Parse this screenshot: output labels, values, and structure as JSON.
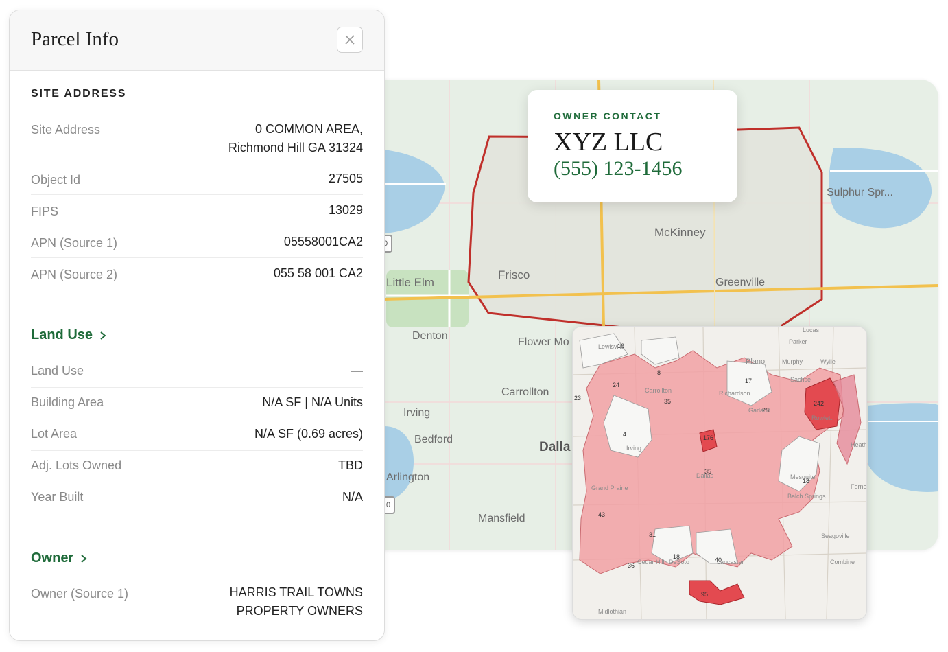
{
  "panel": {
    "title": "Parcel Info",
    "close_icon": "close-icon",
    "site_section": {
      "heading": "SITE ADDRESS",
      "rows": [
        {
          "label": "Site Address",
          "value_line1": "0 COMMON AREA,",
          "value_line2": "Richmond Hill GA 31324"
        },
        {
          "label": "Object Id",
          "value": "27505"
        },
        {
          "label": "FIPS",
          "value": "13029"
        },
        {
          "label": "APN (Source 1)",
          "value": "05558001CA2"
        },
        {
          "label": "APN (Source 2)",
          "value": "055 58 001 CA2"
        }
      ]
    },
    "land_use_section": {
      "link": "Land Use",
      "rows": [
        {
          "label": "Land Use",
          "value": "—"
        },
        {
          "label": "Building Area",
          "value": "N/A SF | N/A Units"
        },
        {
          "label": "Lot Area",
          "value": "N/A SF (0.69 acres)"
        },
        {
          "label": "Adj. Lots Owned",
          "value": "TBD"
        },
        {
          "label": "Year Built",
          "value": "N/A"
        }
      ]
    },
    "owner_section": {
      "link": "Owner",
      "rows": [
        {
          "label": "Owner (Source 1)",
          "value_line1": "HARRIS TRAIL TOWNS",
          "value_line2": "PROPERTY OWNERS"
        }
      ]
    }
  },
  "owner_contact": {
    "label": "OWNER CONTACT",
    "name": "XYZ LLC",
    "phone": "(555) 123-1456"
  },
  "map": {
    "cities": [
      "Sulphur Spr...",
      "McKinney",
      "Little Elm",
      "Frisco",
      "Greenville",
      "Denton",
      "Flower Mo",
      "Carrollton",
      "Irving",
      "Bedford",
      "Dalla",
      "Arlington",
      "Mansfield"
    ],
    "shields": [
      "0",
      "0"
    ]
  },
  "inset_map": {
    "district_labels": [
      "16",
      "24",
      "8",
      "35",
      "17",
      "28",
      "242",
      "23",
      "4",
      "176",
      "35",
      "18",
      "43",
      "31",
      "18",
      "40",
      "36",
      "95"
    ],
    "places": [
      "Lewisville",
      "Parker",
      "Lucas",
      "Plano",
      "Murphy",
      "Wylie",
      "Carrollton",
      "Richardson",
      "Sachse",
      "Garland",
      "Rowlett",
      "Irving",
      "Dallas",
      "Mesquite",
      "Grand Prairie",
      "Balch Springs",
      "Heath",
      "Seagoville",
      "Cedar Hill",
      "DeSoto",
      "Lancaster",
      "Combine",
      "Midlothian",
      "Forney"
    ],
    "colors": {
      "district": "#f2a1a4",
      "hot": "#e34a50",
      "outline": "#c03a40"
    }
  },
  "colors": {
    "accent_green": "#1f6b3a",
    "boundary_red": "#c0302b",
    "road_yellow": "#f2c14e",
    "water": "#a9cfe6",
    "park": "#c8e2c0"
  }
}
